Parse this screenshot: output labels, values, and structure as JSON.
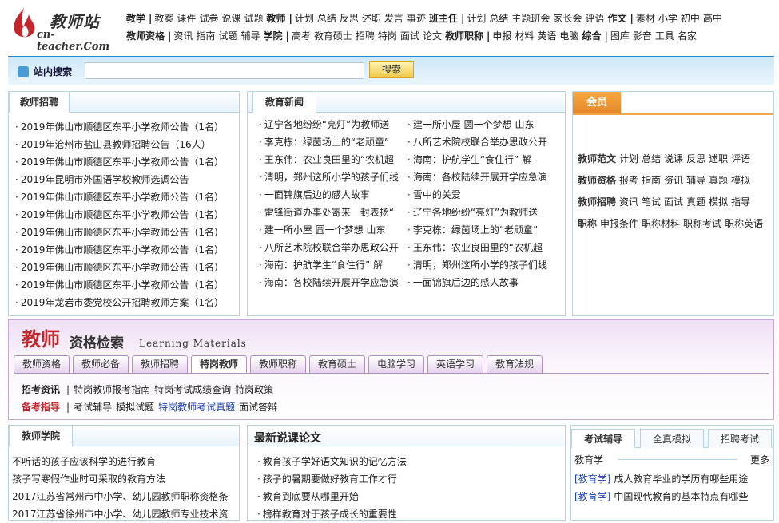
{
  "logo": {
    "cn": "教师站",
    "en": "cn-teacher.Com"
  },
  "nav": {
    "row1": [
      {
        "t": "教学",
        "b": true
      },
      {
        "t": "教案"
      },
      {
        "t": "课件"
      },
      {
        "t": "试卷"
      },
      {
        "t": "说课"
      },
      {
        "t": "试题"
      },
      {
        "t": "教师",
        "b": true
      },
      {
        "t": "计划"
      },
      {
        "t": "总结"
      },
      {
        "t": "反思"
      },
      {
        "t": "述职"
      },
      {
        "t": "发言"
      },
      {
        "t": "事迹"
      },
      {
        "t": "班主任",
        "b": true
      },
      {
        "t": "计划"
      },
      {
        "t": "总结"
      },
      {
        "t": "主题班会"
      },
      {
        "t": "家长会"
      },
      {
        "t": "评语"
      },
      {
        "t": "作文",
        "b": true
      },
      {
        "t": "素材"
      },
      {
        "t": "小学"
      },
      {
        "t": "初中"
      },
      {
        "t": "高中"
      }
    ],
    "row2": [
      {
        "t": "教师资格",
        "b": true
      },
      {
        "t": "资讯"
      },
      {
        "t": "指南"
      },
      {
        "t": "试题"
      },
      {
        "t": "辅导"
      },
      {
        "t": "学院",
        "b": true
      },
      {
        "t": "高考"
      },
      {
        "t": "教育硕士"
      },
      {
        "t": "招聘"
      },
      {
        "t": "特岗"
      },
      {
        "t": "面试"
      },
      {
        "t": "论文"
      },
      {
        "t": "教师职称",
        "b": true
      },
      {
        "t": "申报"
      },
      {
        "t": "材料"
      },
      {
        "t": "英语"
      },
      {
        "t": "电脑"
      },
      {
        "t": "综合",
        "b": true
      },
      {
        "t": "图库"
      },
      {
        "t": "影音"
      },
      {
        "t": "工具"
      },
      {
        "t": "名家"
      }
    ]
  },
  "search": {
    "label": "站内搜索",
    "placeholder": "",
    "button": "搜索"
  },
  "recruit": {
    "tab": "教师招聘",
    "items": [
      "2019年佛山市顺德区东平小学教师公告（1名）",
      "2019年沧州市盐山县教师招聘公告（16人）",
      "2019年佛山市顺德区东平小学教师公告（1名）",
      "2019年昆明市外国语学校教师选调公告",
      "2019年佛山市顺德区东平小学教师公告（1名）",
      "2019年佛山市顺德区东平小学教师公告（1名）",
      "2019年佛山市顺德区东平小学教师公告（1名）",
      "2019年佛山市顺德区东平小学教师公告（1名）",
      "2019年佛山市顺德区东平小学教师公告（1名）",
      "2019年佛山市顺德区东平小学教师公告（1名）",
      "2019年龙岩市委党校公开招聘教师方案（1名）"
    ]
  },
  "news": {
    "tab": "教育新闻",
    "col1": [
      "辽宁各地纷纷“亮灯”为教师送",
      "李克栋：绿茵场上的“老顽童”",
      "王东伟：农业良田里的“农机超",
      "清明，郑州这所小学的孩子们线",
      "一面锦旗后边的感人故事",
      "雷锋街道办事处寄来一封表扬“",
      "建一所小屋 圆一个梦想 山东",
      "八所艺术院校联合举办思政公开",
      "海南：护航学生“食住行” 解",
      "海南：各校陆续开展开学应急演"
    ],
    "col2": [
      "建一所小屋 圆一个梦想 山东",
      "八所艺术院校联合举办思政公开",
      "海南：护航学生“食住行” 解",
      "海南：各校陆续开展开学应急演",
      "雪中的关爱",
      "辽宁各地纷纷“亮灯”为教师送",
      "李克栋：绿茵场上的“老顽童”",
      "王东伟：农业良田里的“农机超",
      "清明，郑州这所小学的孩子们线",
      "一面锦旗后边的感人故事"
    ]
  },
  "vip": {
    "title": "会员",
    "rows": [
      {
        "k": "教师范文",
        "items": [
          "计划",
          "总结",
          "说课",
          "反思",
          "述职",
          "评语"
        ]
      },
      {
        "k": "教师资格",
        "items": [
          "报考",
          "指南",
          "资讯",
          "辅导",
          "真题",
          "模拟"
        ]
      },
      {
        "k": "教师招聘",
        "items": [
          "资讯",
          "笔试",
          "面试",
          "真题",
          "模拟",
          "指导"
        ]
      },
      {
        "k": "职称",
        "items": [
          "申报条件",
          "职称材料",
          "职称考试",
          "职称英语"
        ]
      }
    ]
  },
  "banner": {
    "big": "教师",
    "mid": "资格检索",
    "en": "Learning Materials",
    "tabs": [
      "教师资格",
      "教师必备",
      "教师招聘",
      "特岗教师",
      "教师职称",
      "教育硕士",
      "电脑学习",
      "英语学习",
      "教育法规"
    ],
    "active_tab": "特岗教师",
    "row1": {
      "k": "招考资讯",
      "items": [
        "特岗教师报考指南",
        "特岗考试成绩查询",
        "特岗政策"
      ]
    },
    "row2": {
      "k": "备考指导",
      "items": [
        "考试辅导",
        "模拟试题",
        "特岗教师考试真题",
        "面试答辩"
      ]
    }
  },
  "college": {
    "tab": "教师学院",
    "items": [
      "不听话的孩子应该科学的进行教育",
      "孩子写寒假作业时可采取的教育方法",
      "2017江苏省常州市中小学、幼儿园教师职称资格条",
      "2017江苏省徐州市中小学、幼儿园教师专业技术资"
    ]
  },
  "papers": {
    "title": "最新说课论文",
    "items": [
      "教育孩子学好语文知识的记忆方法",
      "孩子的暑期要做好教育工作才行",
      "教育到底要从哪里开始",
      "榜样教育对于孩子成长的重要性"
    ]
  },
  "exam": {
    "tabs": [
      "考试辅导",
      "全真模拟",
      "招聘考试"
    ],
    "section": "教育学",
    "more": "更多",
    "items": [
      {
        "tag": "[教育学]",
        "text": "成人教育毕业的学历有哪些用途"
      },
      {
        "tag": "[教育学]",
        "text": "中国现代教育的基本特点有哪些"
      }
    ]
  }
}
